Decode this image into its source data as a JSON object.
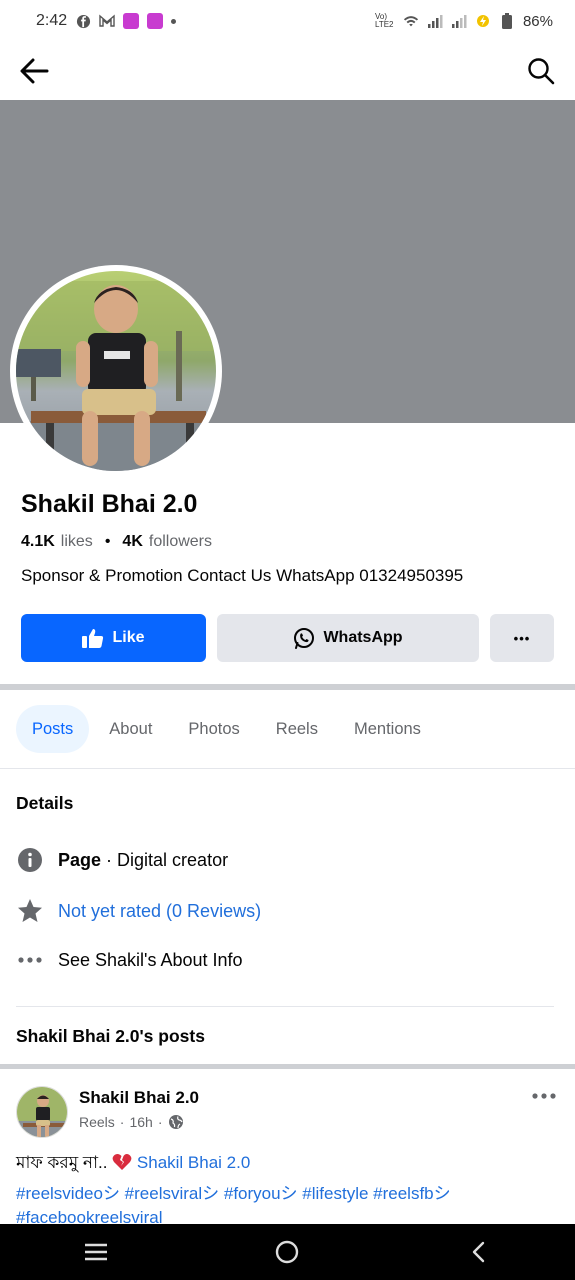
{
  "status_bar": {
    "time": "2:42",
    "battery": "86%",
    "network_label": "Vo) LTE2"
  },
  "header": {
    "back_icon": "back-arrow-icon",
    "search_icon": "search-icon"
  },
  "profile": {
    "name": "Shakil Bhai 2.0",
    "likes_count": "4.1K",
    "likes_label": "likes",
    "followers_count": "4K",
    "followers_label": "followers",
    "bio": "Sponsor & Promotion Contact Us WhatsApp 01324950395"
  },
  "actions": {
    "like_label": "Like",
    "whatsapp_label": "WhatsApp",
    "more_label": "•••"
  },
  "tabs": [
    {
      "label": "Posts",
      "active": true
    },
    {
      "label": "About",
      "active": false
    },
    {
      "label": "Photos",
      "active": false
    },
    {
      "label": "Reels",
      "active": false
    },
    {
      "label": "Mentions",
      "active": false
    }
  ],
  "details": {
    "title": "Details",
    "page_label": "Page",
    "page_type": " · Digital creator",
    "rating_text": "Not yet rated (0 Reviews)",
    "about_text": "See Shakil's About Info"
  },
  "posts_section": {
    "title": "Shakil Bhai 2.0's posts"
  },
  "post": {
    "author": "Shakil Bhai 2.0",
    "meta_type": "Reels",
    "meta_time": "16h",
    "text_prefix": "মাফ করমু না.. ",
    "mention": "Shakil Bhai 2.0",
    "hashtags": "#reelsvideoシ #reelsviralシ #foryouシ #lifestyle #reelsfbシ #facebookreelsviral"
  },
  "colors": {
    "accent": "#0866ff",
    "link": "#216fdb",
    "cover": "#8a8d91"
  }
}
